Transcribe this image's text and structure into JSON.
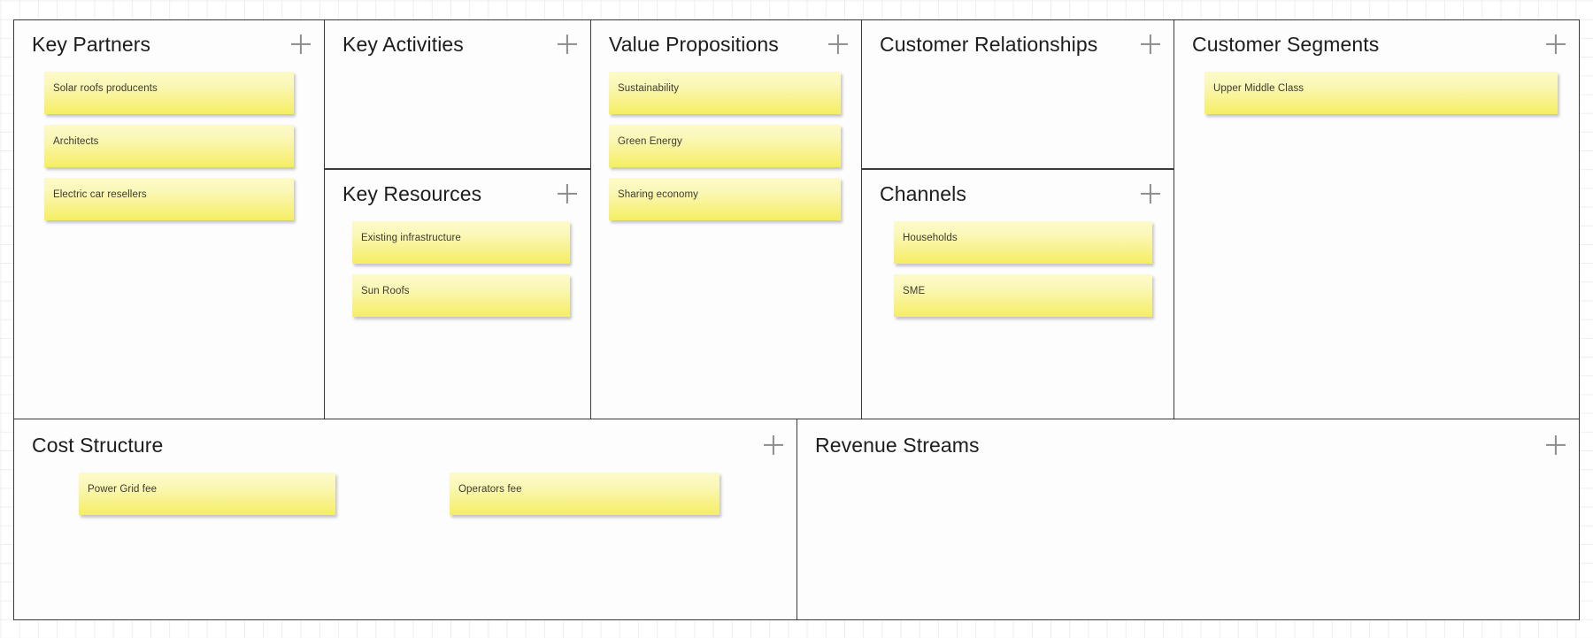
{
  "canvas": {
    "type": "business-model-canvas",
    "add_icon": "plus-icon",
    "colors": {
      "note_top": "#fcfac9",
      "note_bottom": "#f5ee63",
      "border": "#3a3a3a",
      "grid": "#ededed",
      "sheet": "#fdfdfd",
      "title_text": "#1d1d1d",
      "note_text": "#3d3a33",
      "plus_icon": "#8d8d8d"
    }
  },
  "blocks": {
    "key_partners": {
      "title": "Key Partners",
      "notes": [
        {
          "text": "Solar roofs producents"
        },
        {
          "text": "Architects"
        },
        {
          "text": "Electric car resellers"
        }
      ]
    },
    "key_activities": {
      "title": "Key Activities",
      "notes": []
    },
    "key_resources": {
      "title": "Key Resources",
      "notes": [
        {
          "text": "Existing infrastructure"
        },
        {
          "text": "Sun Roofs"
        }
      ]
    },
    "value_propositions": {
      "title": "Value Propositions",
      "notes": [
        {
          "text": "Sustainability"
        },
        {
          "text": "Green Energy"
        },
        {
          "text": "Sharing economy"
        }
      ]
    },
    "customer_relationships": {
      "title": "Customer Relationships",
      "notes": []
    },
    "channels": {
      "title": "Channels",
      "notes": [
        {
          "text": "Households"
        },
        {
          "text": "SME"
        }
      ]
    },
    "customer_segments": {
      "title": "Customer Segments",
      "notes": [
        {
          "text": "Upper Middle Class"
        }
      ]
    },
    "cost_structure": {
      "title": "Cost Structure",
      "notes": [
        {
          "text": "Power Grid fee"
        },
        {
          "text": "Operators fee"
        }
      ]
    },
    "revenue_streams": {
      "title": "Revenue Streams",
      "notes": []
    }
  }
}
